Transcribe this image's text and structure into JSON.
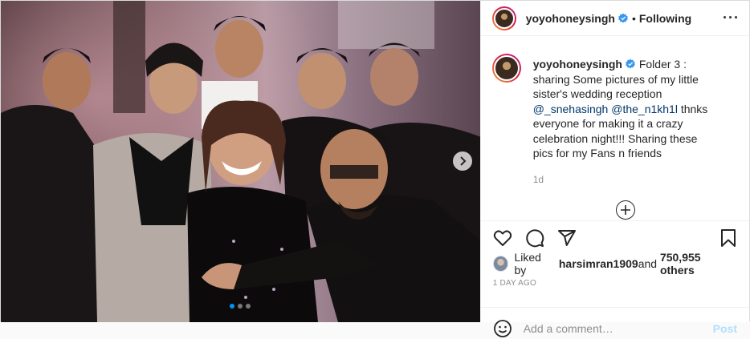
{
  "post": {
    "username": "yoyohoneysingh",
    "follow_status": "Following",
    "separator": "•",
    "more_label": "···",
    "caption": {
      "username": "yoyohoneysingh",
      "text_1": "Folder 3 : sharing Some pictures of my little sister's wedding reception ",
      "mention_1": "@_snehasingh",
      "mention_2": "@the_n1kh1l",
      "text_2": " thnks everyone for making it a crazy celebration night!!! Sharing these pics for my Fans n friends",
      "time": "1d"
    },
    "likes": {
      "prefix": "Liked by ",
      "user": "harsimran1909",
      "middle": " and ",
      "count": "750,955 others"
    },
    "date": "1 DAY AGO",
    "comment_input": {
      "placeholder": "Add a comment…"
    },
    "post_button": "Post",
    "carousel": {
      "total": 3,
      "current": 1
    },
    "colors": {
      "accent": "#0095f6",
      "verified": "#3897f0",
      "post_disabled": "#b2dffc",
      "link": "#00376b"
    }
  }
}
